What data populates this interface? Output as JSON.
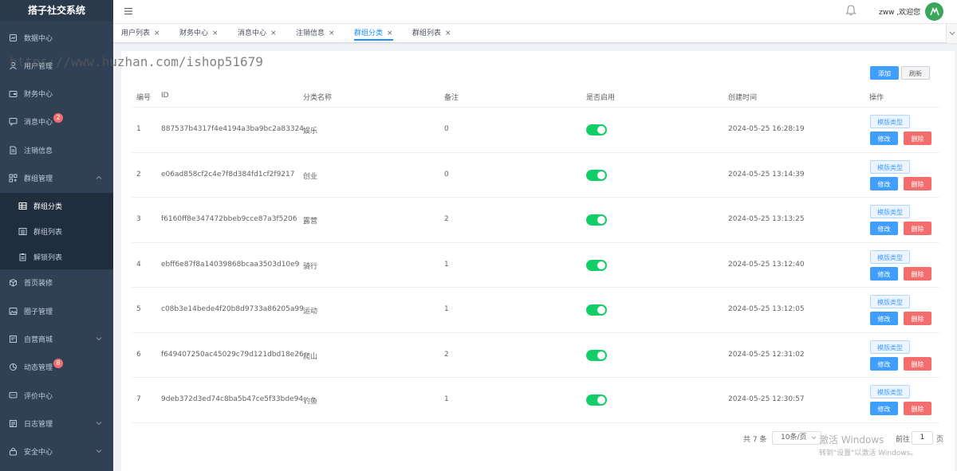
{
  "app": {
    "title": "搭子社交系统"
  },
  "sidebar": {
    "items": [
      {
        "label": "数据中心",
        "icon": "dashboard-icon"
      },
      {
        "label": "用户管理",
        "icon": "user-icon"
      },
      {
        "label": "财务中心",
        "icon": "wallet-icon"
      },
      {
        "label": "消息中心",
        "icon": "message-icon",
        "badge": "2"
      },
      {
        "label": "注销信息",
        "icon": "document-icon"
      },
      {
        "label": "群组管理",
        "icon": "grid-icon",
        "expanded": true
      },
      {
        "label": "首页装修",
        "icon": "box-icon"
      },
      {
        "label": "圈子管理",
        "icon": "image-icon"
      },
      {
        "label": "自营商城",
        "icon": "shop-icon"
      },
      {
        "label": "动态管理",
        "icon": "chart-icon",
        "badge": "8"
      },
      {
        "label": "评价中心",
        "icon": "comment-icon"
      },
      {
        "label": "日志管理",
        "icon": "log-icon"
      },
      {
        "label": "安全中心",
        "icon": "lock-icon"
      }
    ],
    "sub_items": [
      {
        "label": "群组分类",
        "icon": "table-icon",
        "active": true
      },
      {
        "label": "群组列表",
        "icon": "list-icon"
      },
      {
        "label": "解锁列表",
        "icon": "clipboard-icon"
      }
    ]
  },
  "header": {
    "welcome": "zww ,欢迎您"
  },
  "tags": [
    {
      "label": "用户列表"
    },
    {
      "label": "财务中心"
    },
    {
      "label": "消息中心"
    },
    {
      "label": "注销信息"
    },
    {
      "label": "群组分类",
      "active": true
    },
    {
      "label": "群组列表"
    }
  ],
  "toolbar": {
    "add": "添加",
    "refresh": "刷新"
  },
  "table": {
    "columns": [
      "编号",
      "ID",
      "分类名称",
      "备注",
      "是否启用",
      "创建时间",
      "操作"
    ],
    "rows": [
      {
        "no": "1",
        "id": "887537b4317f4e4194a3ba9bc2a83324",
        "name": "娱乐",
        "remark": "0",
        "enabled": true,
        "created": "2024-05-25 16:28:19"
      },
      {
        "no": "2",
        "id": "e06ad858cf2c4e7f8d384fd1cf2f9217",
        "name": "创业",
        "remark": "0",
        "enabled": true,
        "created": "2024-05-25 13:14:39"
      },
      {
        "no": "3",
        "id": "f6160ff8e347472bbeb9cce87a3f5206",
        "name": "露营",
        "remark": "2",
        "enabled": true,
        "created": "2024-05-25 13:13:25"
      },
      {
        "no": "4",
        "id": "ebff6e87f8a14039868bcaa3503d10e9",
        "name": "骑行",
        "remark": "1",
        "enabled": true,
        "created": "2024-05-25 13:12:40"
      },
      {
        "no": "5",
        "id": "c08b3e14bede4f20b8d9733a86205a99",
        "name": "运动",
        "remark": "1",
        "enabled": true,
        "created": "2024-05-25 13:12:05"
      },
      {
        "no": "6",
        "id": "f649407250ac45029c79d121dbd18e26",
        "name": "爬山",
        "remark": "2",
        "enabled": true,
        "created": "2024-05-25 12:31:02"
      },
      {
        "no": "7",
        "id": "9deb372d3ed74c8ba5b47ce5f33bde94",
        "name": "钓鱼",
        "remark": "1",
        "enabled": true,
        "created": "2024-05-25 12:30:57"
      }
    ],
    "actions": {
      "template": "模版类型",
      "edit": "修改",
      "delete": "删除"
    }
  },
  "pagination": {
    "total": "共 7 条",
    "page_size": "10条/页",
    "goto": "前往",
    "page": "1",
    "page_unit": "页"
  },
  "overlay": {
    "watermark": "https://www.huzhan.com/ishop51679",
    "windows_line1": "激活 Windows",
    "windows_line2": "转到\"设置\"以激活 Windows。"
  }
}
